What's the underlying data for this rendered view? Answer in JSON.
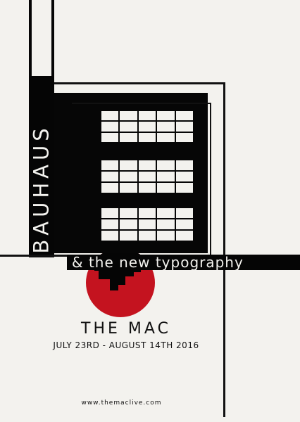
{
  "poster": {
    "vertical_title": "BAUHAUS",
    "subtitle": "& the new typography",
    "venue": "THE MAC",
    "dates": "JULY 23RD - AUGUST 14TH 2016",
    "website": "www.themaclive.com"
  },
  "colors": {
    "background": "#f3f2ee",
    "black": "#050505",
    "accent_red": "#c4131f"
  }
}
